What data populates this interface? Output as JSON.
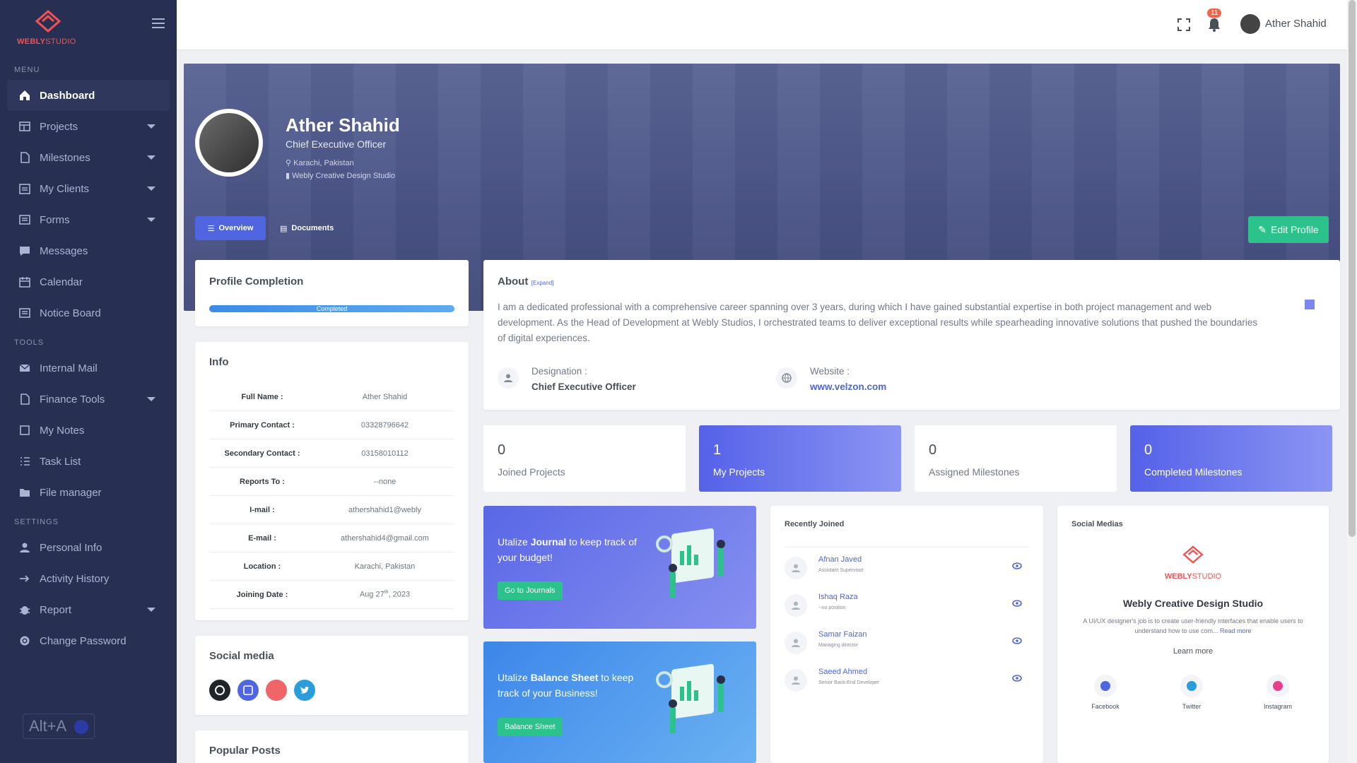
{
  "app": {
    "brand_a": "WEBLY",
    "brand_b": "STUDIO"
  },
  "sidebar": {
    "sections": [
      {
        "title": "MENU",
        "items": [
          {
            "label": "Dashboard",
            "icon": "home-icon",
            "active": true
          },
          {
            "label": "Projects",
            "icon": "layout-icon",
            "caret": true
          },
          {
            "label": "Milestones",
            "icon": "file-icon",
            "caret": true
          },
          {
            "label": "My Clients",
            "icon": "calendar-list-icon",
            "caret": true
          },
          {
            "label": "Forms",
            "icon": "form-icon",
            "caret": true
          },
          {
            "label": "Messages",
            "icon": "chat-icon"
          },
          {
            "label": "Calendar",
            "icon": "calendar-icon"
          },
          {
            "label": "Notice Board",
            "icon": "newspaper-icon"
          }
        ]
      },
      {
        "title": "TOOLS",
        "items": [
          {
            "label": "Internal Mail",
            "icon": "mail-icon"
          },
          {
            "label": "Finance Tools",
            "icon": "file-icon",
            "caret": true
          },
          {
            "label": "My Notes",
            "icon": "note-icon"
          },
          {
            "label": "Task List",
            "icon": "task-list-icon"
          },
          {
            "label": "File manager",
            "icon": "folder-icon"
          }
        ]
      },
      {
        "title": "SETTINGS",
        "items": [
          {
            "label": "Personal Info",
            "icon": "user-icon"
          },
          {
            "label": "Activity History",
            "icon": "arrow-right-icon"
          },
          {
            "label": "Report",
            "icon": "bug-icon",
            "caret": true
          },
          {
            "label": "Change Password",
            "icon": "gear-icon"
          }
        ]
      }
    ],
    "shortcut": "Alt+A"
  },
  "topbar": {
    "notification_count": "11",
    "user_name": "Ather Shahid"
  },
  "profile": {
    "name": "Ather Shahid",
    "role": "Chief Executive Officer",
    "location": "Karachi, Pakistan",
    "organization": "Webly Creative Design Studio",
    "tabs": [
      "Overview",
      "Documents"
    ],
    "edit_label": "Edit Profile"
  },
  "completion": {
    "title": "Profile Completion",
    "progress_label": "Completed",
    "progress": 1.0
  },
  "info": {
    "title": "Info",
    "rows": [
      {
        "k": "Full Name :",
        "v": "Ather Shahid"
      },
      {
        "k": "Primary Contact :",
        "v": "03328796642"
      },
      {
        "k": "Secondary Contact :",
        "v": "03158010112"
      },
      {
        "k": "Reports To :",
        "v": "--none"
      },
      {
        "k": "I-mail :",
        "v": "athershahid1@webly"
      },
      {
        "k": "E-mail :",
        "v": "athershahid4@gmail.com"
      },
      {
        "k": "Location :",
        "v": "Karachi, Pakistan"
      },
      {
        "k": "Joining Date :",
        "v": "Aug 27",
        "sup": "th",
        "v2": ", 2023"
      }
    ]
  },
  "social": {
    "title": "Social media",
    "colors": [
      "#212529",
      "#4f66e0",
      "#f06568",
      "#299cdb"
    ]
  },
  "popular": {
    "title": "Popular Posts"
  },
  "about": {
    "title": "About",
    "expand": "[Expand]",
    "text": "I am a dedicated professional with a comprehensive career spanning over 3 years, during which I have gained substantial expertise in both project management and web development. As the Head of Development at Webly Studios, I orchestrated teams to deliver exceptional results while spearheading innovative solutions that pushed the boundaries of digital experiences.",
    "designation_label": "Designation :",
    "designation": "Chief Executive Officer",
    "website_label": "Website :",
    "website": "www.velzon.com"
  },
  "stats": [
    {
      "num": "0",
      "label": "Joined Projects",
      "style": "white"
    },
    {
      "num": "1",
      "label": "My Projects",
      "style": "blue"
    },
    {
      "num": "0",
      "label": "Assigned Milestones",
      "style": "white"
    },
    {
      "num": "0",
      "label": "Completed Milestones",
      "style": "blue"
    }
  ],
  "promos": [
    {
      "pre": "Utalize ",
      "bold": "Journal",
      "post": " to keep track of your budget!",
      "button": "Go to Journals"
    },
    {
      "pre": "Utalize ",
      "bold": "Balance Sheet",
      "post": " to keep track of your Business!",
      "button": "Balance Sheet"
    }
  ],
  "recently_joined": {
    "title": "Recently Joined",
    "items": [
      {
        "name": "Afnan Javed",
        "position": "Assistant Supervisor"
      },
      {
        "name": "Ishaq Raza",
        "position": "--no position"
      },
      {
        "name": "Samar Faizan",
        "position": "Managing director"
      },
      {
        "name": "Saeed Ahmed",
        "position": "Senior Back-End Developer"
      }
    ]
  },
  "social_medias": {
    "title": "Social Medias",
    "company": "Webly Creative Design Studio",
    "desc": "A UI/UX designer's job is to create user-friendly interfaces that enable users to understand how to use com...",
    "read_more": "Read more",
    "learn_more": "Learn more",
    "items": [
      {
        "label": "Facebook",
        "color": "#4f66e0",
        "icon": "facebook-icon"
      },
      {
        "label": "Twitter",
        "color": "#299cdb",
        "icon": "twitter-icon"
      },
      {
        "label": "Instagram",
        "color": "#e83e8c",
        "icon": "instagram-icon"
      }
    ]
  }
}
